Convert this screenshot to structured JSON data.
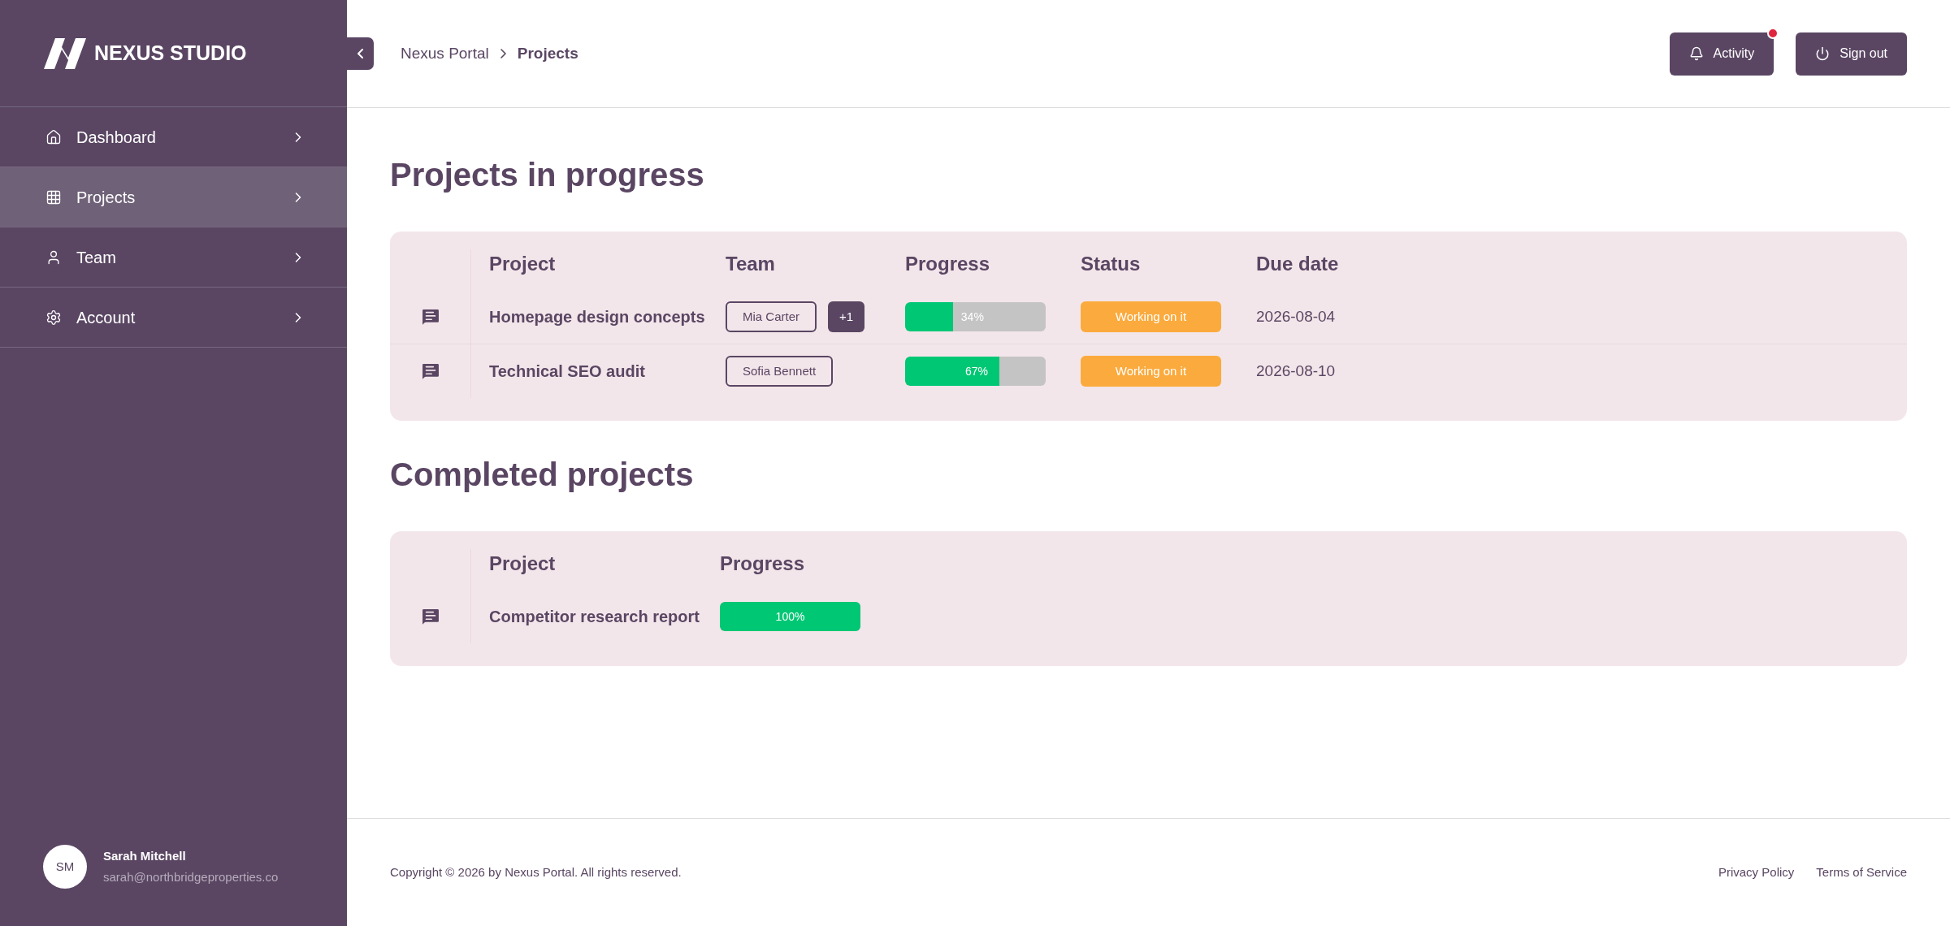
{
  "brand": {
    "name": "NEXUS STUDIO"
  },
  "sidebar": {
    "items": [
      {
        "label": "Dashboard",
        "kind": "home",
        "selected": false
      },
      {
        "label": "Projects",
        "kind": "grid",
        "selected": true
      },
      {
        "label": "Team",
        "kind": "user",
        "selected": false
      },
      {
        "label": "Account",
        "kind": "gear",
        "selected": false
      }
    ],
    "user": {
      "initials": "SM",
      "name": "Sarah Mitchell",
      "email": "sarah@northbridgeproperties.co"
    }
  },
  "breadcrumb": [
    "Nexus Portal",
    "Projects"
  ],
  "header_buttons": [
    {
      "label": "Activity",
      "kind": "bell",
      "notification": true
    },
    {
      "label": "Sign out",
      "kind": "power",
      "notification": false
    }
  ],
  "in_progress": {
    "title": "Projects in progress",
    "columns": [
      "Project",
      "Team",
      "Progress",
      "Status",
      "Due date"
    ],
    "rows": [
      {
        "project": "Homepage design concepts",
        "team": [
          {
            "label": "Mia Carter",
            "kind": "person"
          },
          {
            "label": "+1",
            "kind": "more"
          }
        ],
        "progress": {
          "level": 0.34,
          "reading": "34%"
        },
        "status": "Working on it",
        "due": "2026-08-04"
      },
      {
        "project": "Technical SEO audit",
        "team": [
          {
            "label": "Sofia Bennett",
            "kind": "person"
          }
        ],
        "progress": {
          "level": 0.67,
          "reading": "67%"
        },
        "status": "Working on it",
        "due": "2026-08-10"
      }
    ]
  },
  "completed": {
    "title": "Completed projects",
    "columns": [
      "Project",
      "Progress"
    ],
    "rows": [
      {
        "project": "Competitor research report",
        "progress": {
          "level": 1,
          "reading": "100%"
        }
      }
    ]
  },
  "footer": {
    "copyright": "Copyright © 2026 by Nexus Portal. All rights reserved.",
    "links": [
      "Privacy Policy",
      "Terms of Service"
    ]
  }
}
